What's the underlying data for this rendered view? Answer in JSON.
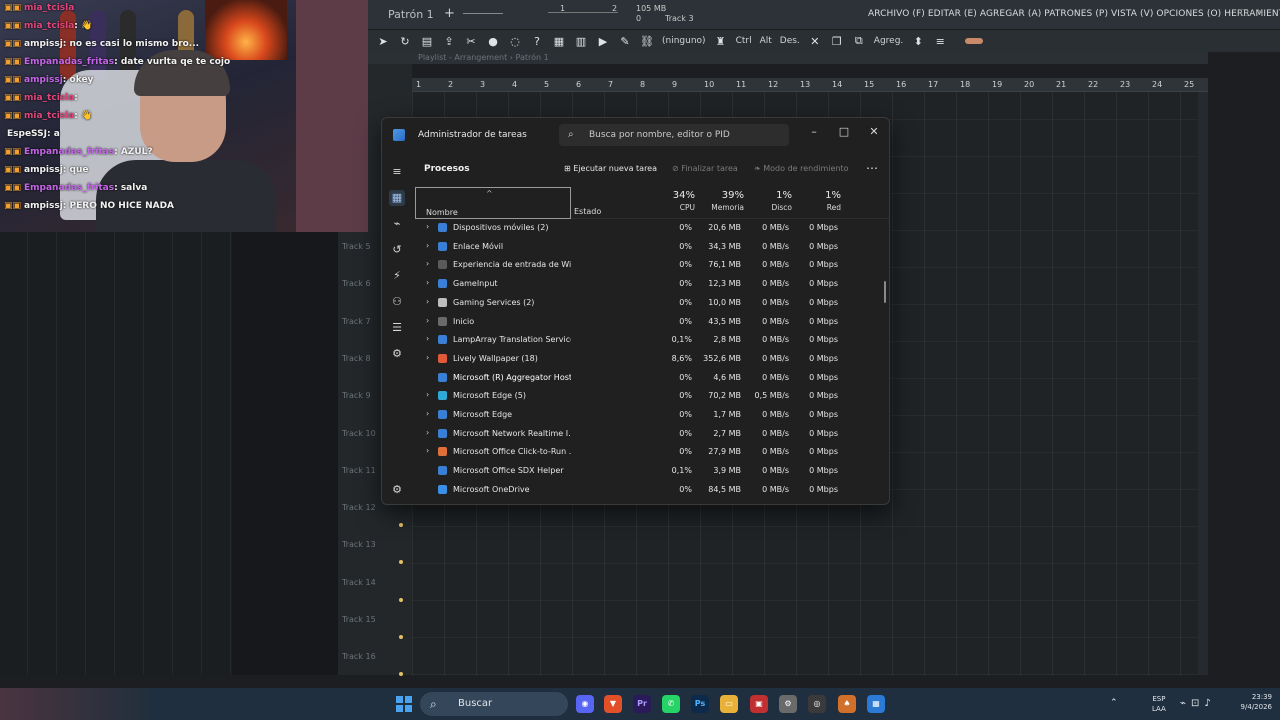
{
  "fl": {
    "pattern": "Patrón 1",
    "menu": "ARCHIVO (F) EDITAR (E) AGREGAR (A) PATRONES (P) VISTA (V) OPCIONES (O) HERRAMIENTAS (T) AYUDA",
    "mem": "105 MB",
    "mem2": "0",
    "beat1": "1",
    "beat2": "2",
    "track": "Track 3",
    "toolbar_none": "(ninguno)",
    "toolbar_ctrl": "Ctrl",
    "toolbar_alt": "Alt",
    "toolbar_des": "Des.",
    "toolbar_agreg": "Agreg.",
    "playlist_title": "Playlist - Arrangement › Patrón 1",
    "ruler": [
      "1",
      "2",
      "3",
      "4",
      "5",
      "6",
      "7",
      "8",
      "9",
      "10",
      "11",
      "12",
      "13",
      "14",
      "15",
      "16",
      "17",
      "18",
      "19",
      "20",
      "21",
      "22",
      "23",
      "24",
      "25"
    ],
    "tracks": [
      "Track 5",
      "Track 6",
      "Track 7",
      "Track 8",
      "Track 9",
      "Track 10",
      "Track 11",
      "Track 12",
      "Track 13",
      "Track 14",
      "Track 15",
      "Track 16"
    ]
  },
  "chat": [
    {
      "user": "mia_tcisla",
      "color": "#e0457b",
      "msg": ""
    },
    {
      "user": "mia_tcisla",
      "color": "#e0457b",
      "msg": ": 👋"
    },
    {
      "user": "ampissj",
      "color": "#f2f2f2",
      "msg": ": no es casi lo mismo bro..."
    },
    {
      "user": "Empanadas_fritas",
      "color": "#c466e8",
      "msg": ": date vurlta qe te cojo"
    },
    {
      "user": "ampissj",
      "color": "#c466e8",
      "msg": ": okey"
    },
    {
      "user": "mia_tcisla",
      "color": "#e0457b",
      "msg": ":"
    },
    {
      "user": "mia_tcisla",
      "color": "#e0457b",
      "msg": ": 👋"
    },
    {
      "user": "EspeSSJ",
      "color": "#f2f2f2",
      "msg": ": a"
    },
    {
      "user": "Empanadas_fritas",
      "color": "#c466e8",
      "msg": ": AZUL?"
    },
    {
      "user": "ampissj",
      "color": "#f2f2f2",
      "msg": ": que"
    },
    {
      "user": "Empanadas_fritas",
      "color": "#c466e8",
      "msg": ": salva"
    },
    {
      "user": "ampissj",
      "color": "#f2f2f2",
      "msg": ": PERO NO HICE NADA"
    }
  ],
  "taskmgr": {
    "title": "Administrador de tareas",
    "search_placeholder": "Busca por nombre, editor o PID",
    "section": "Procesos",
    "run_new": "Ejecutar nueva tarea",
    "end_task": "Finalizar tarea",
    "efficiency": "Modo de rendimiento",
    "col_name": "Nombre",
    "col_status": "Estado",
    "cpu_pct": "34%",
    "cpu_label": "CPU",
    "mem_pct": "39%",
    "mem_label": "Memoria",
    "disk_pct": "1%",
    "disk_label": "Disco",
    "net_pct": "1%",
    "net_label": "Red",
    "rows": [
      {
        "name": "Dispositivos móviles (2)",
        "cpu": "0%",
        "mem": "20,6 MB",
        "disk": "0 MB/s",
        "net": "0 Mbps",
        "expand": true,
        "icon": "#3a7fd6"
      },
      {
        "name": "Enlace Móvil",
        "cpu": "0%",
        "mem": "34,3 MB",
        "disk": "0 MB/s",
        "net": "0 Mbps",
        "expand": true,
        "icon": "#3a7fd6"
      },
      {
        "name": "Experiencia de entrada de Win...",
        "cpu": "0%",
        "mem": "76,1 MB",
        "disk": "0 MB/s",
        "net": "0 Mbps",
        "expand": true,
        "icon": "#5a5a5a"
      },
      {
        "name": "GameInput",
        "cpu": "0%",
        "mem": "12,3 MB",
        "disk": "0 MB/s",
        "net": "0 Mbps",
        "expand": true,
        "icon": "#3a7fd6"
      },
      {
        "name": "Gaming Services (2)",
        "cpu": "0%",
        "mem": "10,0 MB",
        "disk": "0 MB/s",
        "net": "0 Mbps",
        "expand": true,
        "icon": "#bdbdbd"
      },
      {
        "name": "Inicio",
        "cpu": "0%",
        "mem": "43,5 MB",
        "disk": "0 MB/s",
        "net": "0 Mbps",
        "expand": true,
        "icon": "#6a6a6a"
      },
      {
        "name": "LampArray Translation Service",
        "cpu": "0,1%",
        "mem": "2,8 MB",
        "disk": "0 MB/s",
        "net": "0 Mbps",
        "expand": true,
        "icon": "#3a7fd6"
      },
      {
        "name": "Lively Wallpaper (18)",
        "cpu": "8,6%",
        "mem": "352,6 MB",
        "disk": "0 MB/s",
        "net": "0 Mbps",
        "expand": true,
        "icon": "#e05a3a"
      },
      {
        "name": "Microsoft (R) Aggregator Host",
        "cpu": "0%",
        "mem": "4,6 MB",
        "disk": "0 MB/s",
        "net": "0 Mbps",
        "expand": false,
        "icon": "#3a7fd6"
      },
      {
        "name": "Microsoft Edge (5)",
        "cpu": "0%",
        "mem": "70,2 MB",
        "disk": "0,5 MB/s",
        "net": "0 Mbps",
        "expand": true,
        "icon": "#2fa9d6"
      },
      {
        "name": "Microsoft Edge",
        "cpu": "0%",
        "mem": "1,7 MB",
        "disk": "0 MB/s",
        "net": "0 Mbps",
        "expand": true,
        "icon": "#3a7fd6"
      },
      {
        "name": "Microsoft Network Realtime I...",
        "cpu": "0%",
        "mem": "2,7 MB",
        "disk": "0 MB/s",
        "net": "0 Mbps",
        "expand": true,
        "icon": "#3a7fd6"
      },
      {
        "name": "Microsoft Office Click-to-Run ...",
        "cpu": "0%",
        "mem": "27,9 MB",
        "disk": "0 MB/s",
        "net": "0 Mbps",
        "expand": true,
        "icon": "#e0703a"
      },
      {
        "name": "Microsoft Office SDX Helper",
        "cpu": "0,1%",
        "mem": "3,9 MB",
        "disk": "0 MB/s",
        "net": "0 Mbps",
        "expand": false,
        "icon": "#3a7fd6"
      },
      {
        "name": "Microsoft OneDrive",
        "cpu": "0%",
        "mem": "84,5 MB",
        "disk": "0 MB/s",
        "net": "0 Mbps",
        "expand": false,
        "icon": "#3a8fe6"
      }
    ]
  },
  "taskbar": {
    "search": "Buscar",
    "lang_top": "ESP",
    "lang_bottom": "LAA",
    "time": "23:39",
    "date": "9/4/2026"
  }
}
